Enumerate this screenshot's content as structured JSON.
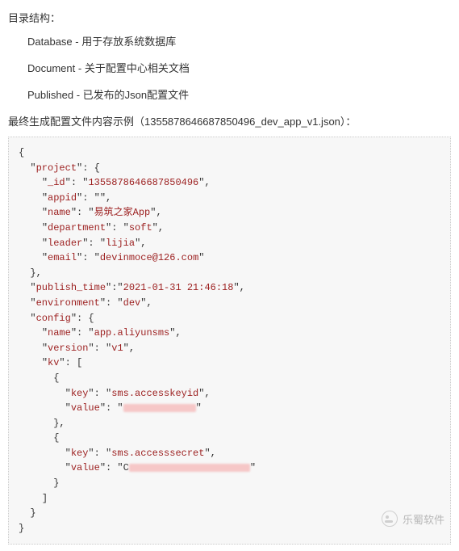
{
  "heading": "目录结构：",
  "dirs": [
    {
      "name": "Database",
      "desc": "用于存放系统数据库"
    },
    {
      "name": "Document",
      "desc": "关于配置中心相关文档"
    },
    {
      "name": "Published",
      "desc": "已发布的Json配置文件"
    }
  ],
  "example_line": "最终生成配置文件内容示例（1355878646687850496_dev_app_v1.json）：",
  "json_example": {
    "project": {
      "_id": "1355878646687850496",
      "appid": "",
      "name": "易筑之家App",
      "department": "soft",
      "leader": "lijia",
      "email": "devinmoce@126.com"
    },
    "publish_time": "2021-01-31 21:46:18",
    "environment": "dev",
    "config": {
      "name": "app.aliyunsms",
      "version": "v1",
      "kv": [
        {
          "key": "sms.accesskeyid",
          "value": "(redacted)"
        },
        {
          "key": "sms.accesssecret",
          "value": "C(redacted)"
        }
      ]
    }
  },
  "watermark": "乐蜀软件"
}
